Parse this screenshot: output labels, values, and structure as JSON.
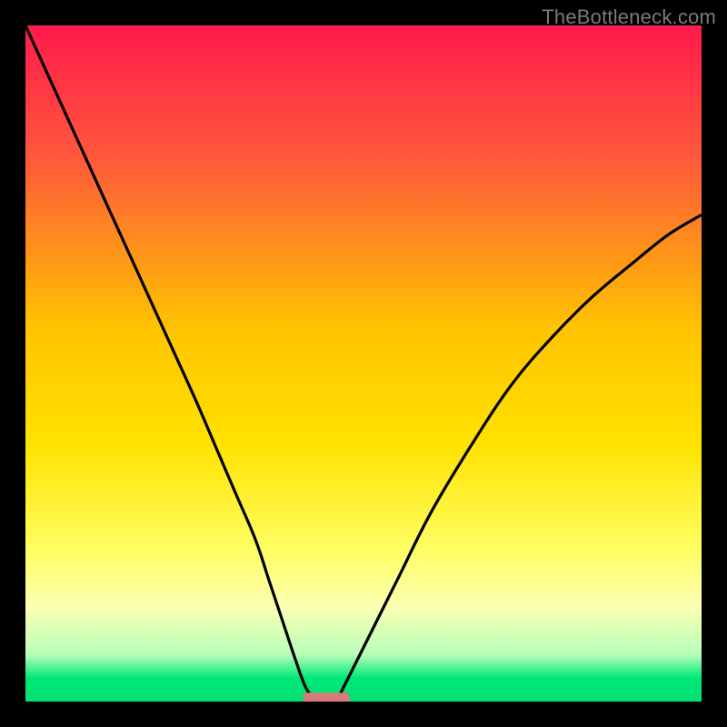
{
  "watermark": "TheBottleneck.com",
  "chart_data": {
    "type": "line",
    "title": "",
    "xlabel": "",
    "ylabel": "",
    "xlim": [
      0,
      100
    ],
    "ylim": [
      0,
      100
    ],
    "optimum_x": 43,
    "optimum_width": 6,
    "gradient_stops": [
      {
        "offset": 0.0,
        "color": "#ff1a4b"
      },
      {
        "offset": 0.2,
        "color": "#ff5a3a"
      },
      {
        "offset": 0.45,
        "color": "#ffc400"
      },
      {
        "offset": 0.62,
        "color": "#ffe200"
      },
      {
        "offset": 0.78,
        "color": "#ffff66"
      },
      {
        "offset": 0.86,
        "color": "#fbffb3"
      },
      {
        "offset": 0.93,
        "color": "#b9ffb9"
      },
      {
        "offset": 0.965,
        "color": "#00e878"
      },
      {
        "offset": 1.0,
        "color": "#00e070"
      }
    ],
    "series": [
      {
        "name": "left-curve",
        "x": [
          0,
          5,
          10,
          15,
          20,
          25,
          28,
          31,
          34,
          36,
          38,
          40,
          41.5,
          43
        ],
        "values": [
          100,
          89,
          78,
          67,
          56,
          45,
          38,
          31,
          24,
          18,
          12,
          6,
          2,
          0
        ]
      },
      {
        "name": "right-curve",
        "x": [
          46,
          48,
          51,
          55,
          60,
          66,
          72,
          78,
          84,
          90,
          95,
          100
        ],
        "values": [
          0,
          4,
          10,
          18,
          28,
          38,
          47,
          54,
          60,
          65,
          69,
          72
        ]
      }
    ],
    "marker": {
      "x_center": 44.5,
      "y": 0.5,
      "width": 7,
      "color": "#d97a7a"
    }
  }
}
